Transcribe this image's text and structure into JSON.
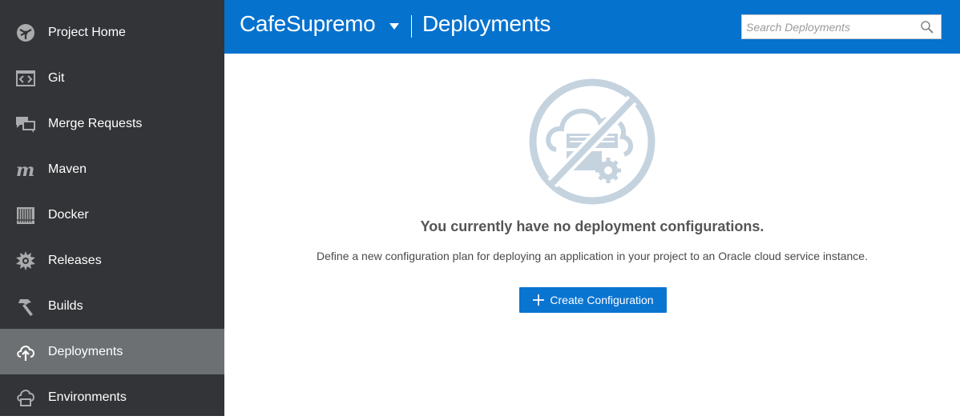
{
  "sidebar": {
    "items": [
      {
        "label": "Project Home",
        "icon": "project-home-icon"
      },
      {
        "label": "Git",
        "icon": "git-icon"
      },
      {
        "label": "Merge Requests",
        "icon": "merge-requests-icon"
      },
      {
        "label": "Maven",
        "icon": "maven-icon"
      },
      {
        "label": "Docker",
        "icon": "docker-icon"
      },
      {
        "label": "Releases",
        "icon": "releases-icon"
      },
      {
        "label": "Builds",
        "icon": "builds-icon"
      },
      {
        "label": "Deployments",
        "icon": "deployments-icon",
        "active": true
      },
      {
        "label": "Environments",
        "icon": "environments-icon"
      }
    ]
  },
  "header": {
    "project_name": "CafeSupremo",
    "page_title": "Deployments",
    "search_placeholder": "Search Deployments"
  },
  "main": {
    "empty_title": "You currently have no deployment configurations.",
    "empty_description": "Define a new configuration plan for deploying an application in your project to an Oracle cloud service instance.",
    "create_button_label": "Create Configuration"
  },
  "colors": {
    "sidebar_bg": "#333437",
    "sidebar_active_bg": "#6d7073",
    "header_bg": "#0572ce",
    "button_bg": "#0a74d1",
    "illustration": "#c5d3df"
  }
}
